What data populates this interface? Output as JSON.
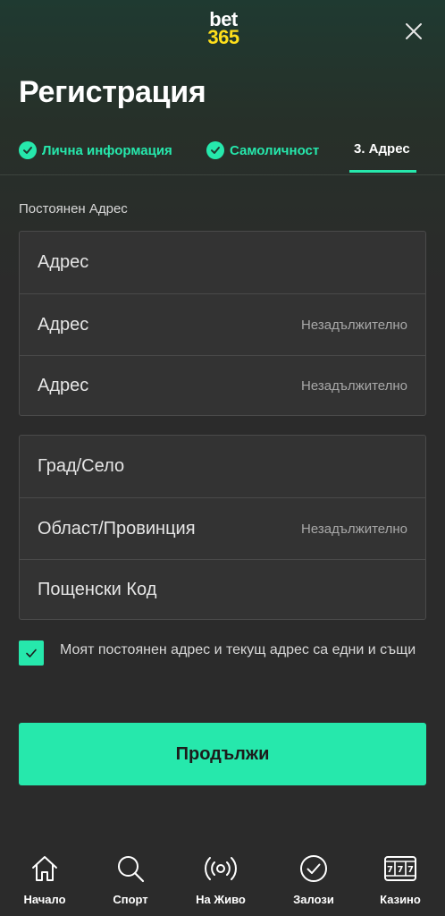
{
  "header": {
    "logo_line1": "bet",
    "logo_line2": "365",
    "title": "Регистрация"
  },
  "steps": [
    {
      "label": "Лична информация",
      "done": true
    },
    {
      "label": "Самоличност",
      "done": true
    },
    {
      "label": "3. Адрес",
      "active": true
    }
  ],
  "form": {
    "section_label": "Постоянен Адрес",
    "address_fields": [
      {
        "placeholder": "Адрес",
        "optional_label": ""
      },
      {
        "placeholder": "Адрес",
        "optional_label": "Незадължително"
      },
      {
        "placeholder": "Адрес",
        "optional_label": "Незадължително"
      }
    ],
    "location_fields": [
      {
        "placeholder": "Град/Село",
        "optional_label": ""
      },
      {
        "placeholder": "Област/Провинция",
        "optional_label": "Незадължително"
      },
      {
        "placeholder": "Пощенски Код",
        "optional_label": ""
      }
    ],
    "same_address_checked": true,
    "same_address_label": "Моят постоянен адрес и текущ адрес са едни и същи",
    "continue_label": "Продължи"
  },
  "nav": [
    {
      "label": "Начало",
      "icon": "home-icon"
    },
    {
      "label": "Спорт",
      "icon": "search-icon"
    },
    {
      "label": "На Живо",
      "icon": "live-broadcast-icon"
    },
    {
      "label": "Залози",
      "icon": "check-circle-icon"
    },
    {
      "label": "Казино",
      "icon": "slot-machine-icon"
    }
  ],
  "colors": {
    "accent": "#26e8ac",
    "logo_yellow": "#ffdf1b",
    "background": "#2b2b2b"
  }
}
